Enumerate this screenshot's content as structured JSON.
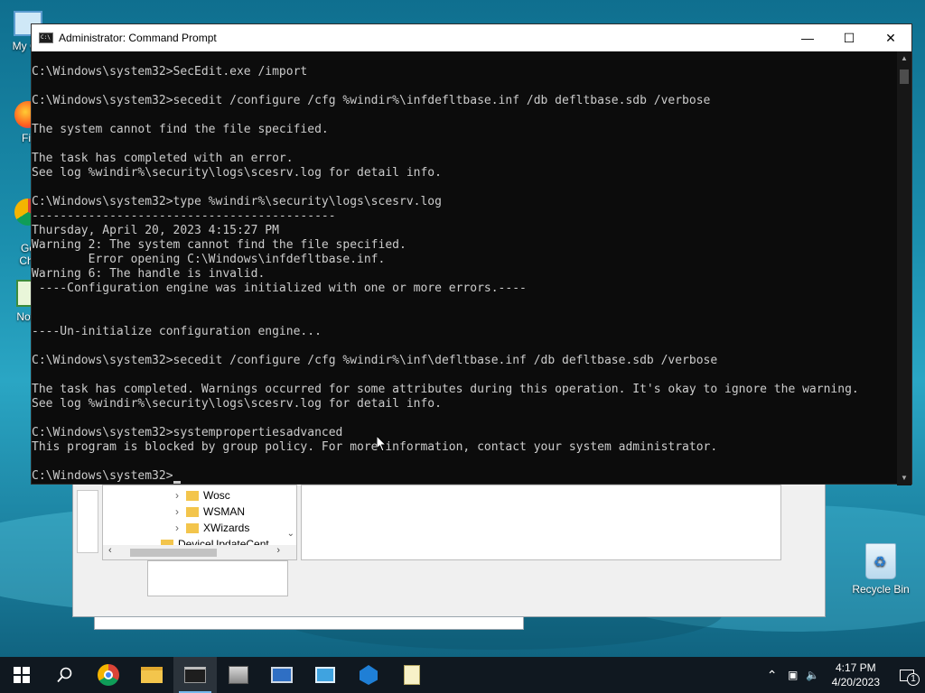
{
  "desktop": {
    "icons": [
      {
        "name": "my-computer",
        "label": "My Co"
      },
      {
        "name": "firefox",
        "label": "Fir"
      },
      {
        "name": "google-chrome",
        "label": "Go\nChr"
      },
      {
        "name": "notepad",
        "label": "Note"
      },
      {
        "name": "recycle-bin",
        "label": "Recycle Bin"
      }
    ]
  },
  "background_window": {
    "tree_items": [
      "Wosc",
      "WSMAN",
      "XWizards",
      "DeviceUpdateCent"
    ]
  },
  "cmd": {
    "title": "Administrator: Command Prompt",
    "lines": [
      "C:\\Windows\\system32>SecEdit.exe /import",
      "",
      "C:\\Windows\\system32>secedit /configure /cfg %windir%\\infdefltbase.inf /db defltbase.sdb /verbose",
      "",
      "The system cannot find the file specified.",
      "",
      "The task has completed with an error.",
      "See log %windir%\\security\\logs\\scesrv.log for detail info.",
      "",
      "C:\\Windows\\system32>type %windir%\\security\\logs\\scesrv.log",
      "-------------------------------------------",
      "Thursday, April 20, 2023 4:15:27 PM",
      "Warning 2: The system cannot find the file specified.",
      "        Error opening C:\\Windows\\infdefltbase.inf.",
      "Warning 6: The handle is invalid.",
      " ----Configuration engine was initialized with one or more errors.----",
      "",
      "",
      "----Un-initialize configuration engine...",
      "",
      "C:\\Windows\\system32>secedit /configure /cfg %windir%\\inf\\defltbase.inf /db defltbase.sdb /verbose",
      "",
      "The task has completed. Warnings occurred for some attributes during this operation. It's okay to ignore the warning.",
      "See log %windir%\\security\\logs\\scesrv.log for detail info.",
      "",
      "C:\\Windows\\system32>systempropertiesadvanced",
      "This program is blocked by group policy. For more information, contact your system administrator.",
      "",
      "C:\\Windows\\system32>"
    ]
  },
  "taskbar": {
    "items": [
      "start",
      "search",
      "chrome",
      "file-explorer",
      "command-prompt",
      "server-manager",
      "remote-desktop",
      "control-panel",
      "hyper-v",
      "notepad"
    ],
    "active_item": "command-prompt",
    "time": "4:17 PM",
    "date": "4/20/2023",
    "notification_count": "1"
  },
  "colors": {
    "console_bg": "#0c0c0c",
    "console_text": "#cccccc",
    "taskbar_bg": "#101820",
    "accent": "#76b9ed"
  }
}
